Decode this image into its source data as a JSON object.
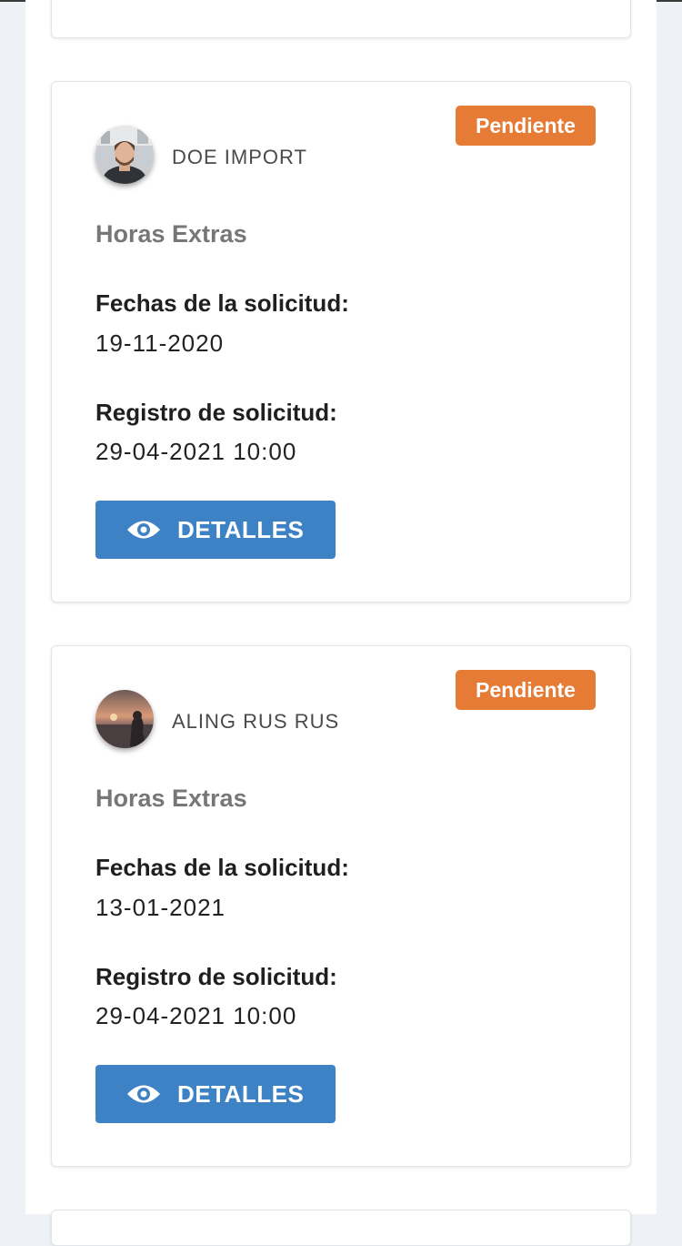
{
  "cards": [
    {
      "user_name": "DOE IMPORT",
      "status": "Pendiente",
      "type": "Horas Extras",
      "fechas_label": "Fechas de la solicitud:",
      "fechas_value": "19-11-2020",
      "registro_label": "Registro de solicitud:",
      "registro_value": "29-04-2021 10:00",
      "button_label": "DETALLES",
      "button_icon": "eye-icon"
    },
    {
      "user_name": "ALING RUS RUS",
      "status": "Pendiente",
      "type": "Horas Extras",
      "fechas_label": "Fechas de la solicitud:",
      "fechas_value": "13-01-2021",
      "registro_label": "Registro de solicitud:",
      "registro_value": "29-04-2021 10:00",
      "button_label": "DETALLES",
      "button_icon": "eye-icon"
    }
  ],
  "colors": {
    "status_pending": "#e67b36",
    "button": "#3d82c4",
    "background": "#eef1f6"
  }
}
